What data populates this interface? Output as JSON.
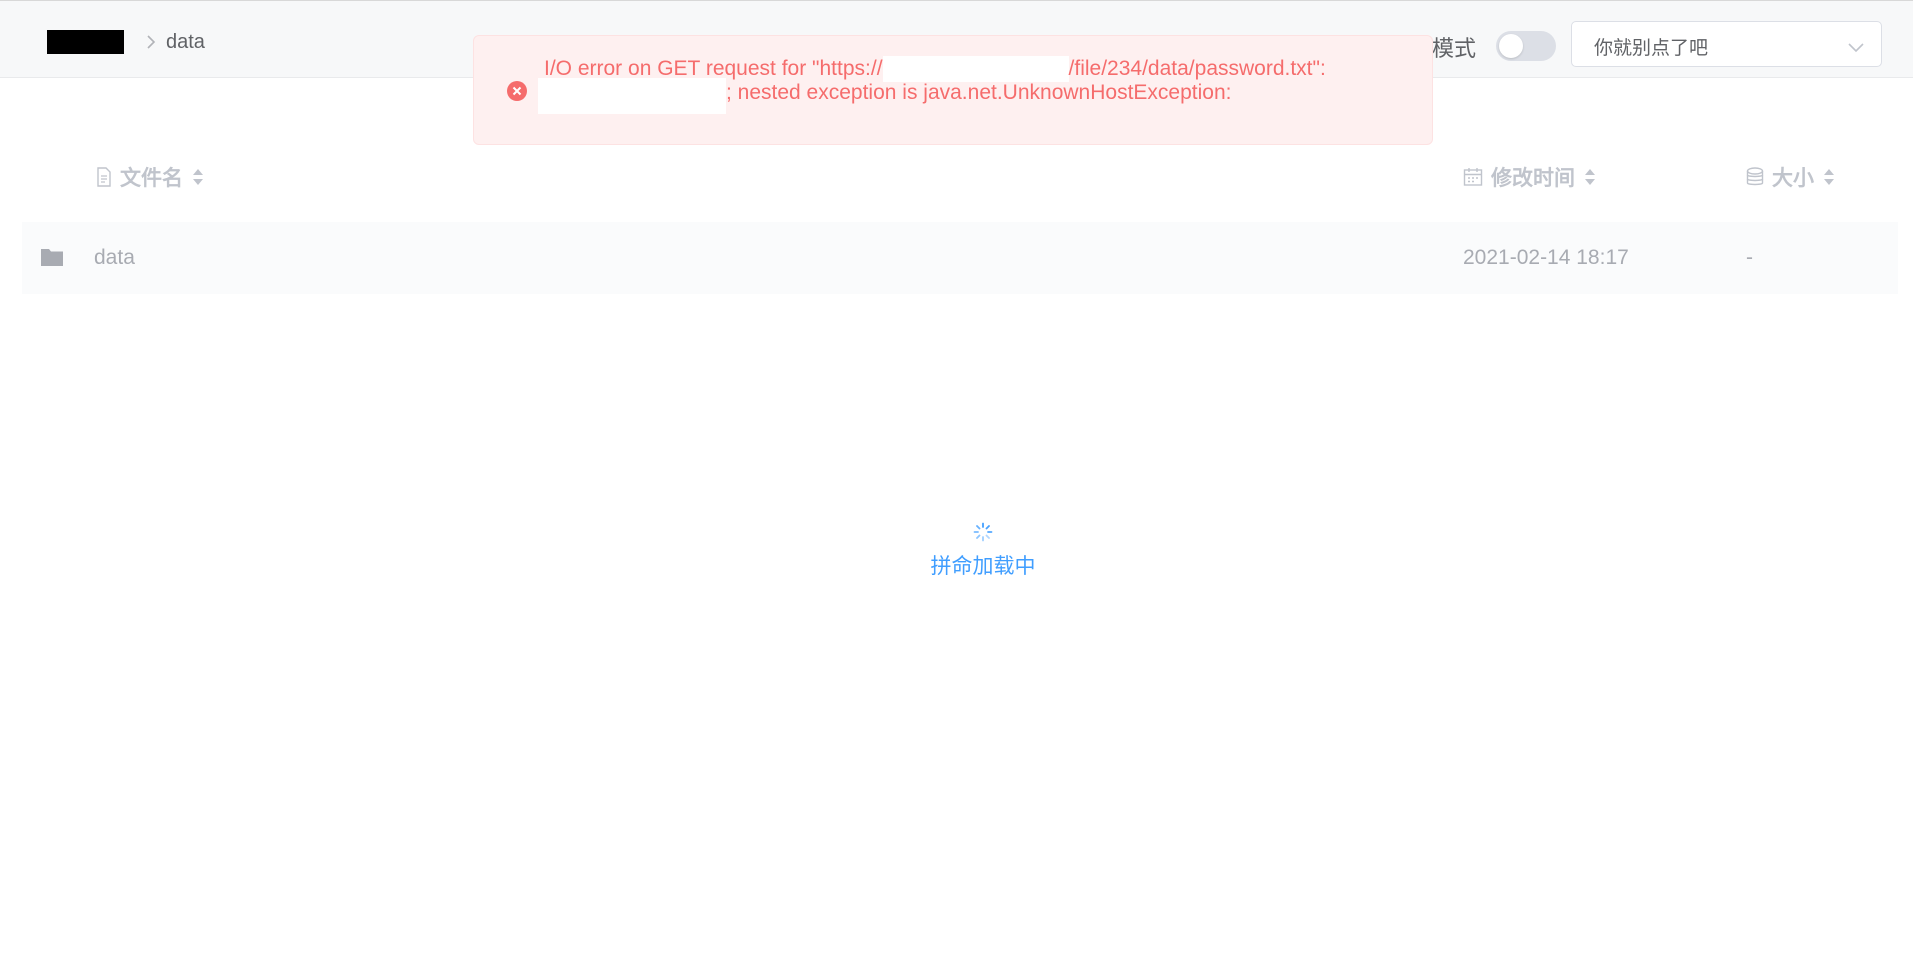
{
  "header": {
    "breadcrumb_current": "data",
    "mode_label": "模式",
    "toggle_on": false,
    "select_value": "你就别点了吧"
  },
  "alert": {
    "line1_prefix": "I/O error on GET request for \"https://",
    "line1_suffix": "/file/234/data/password.txt\":",
    "line2_suffix": "; nested exception is java.net.UnknownHostException:",
    "color": "#f56c6c"
  },
  "table": {
    "columns": {
      "name": "文件名",
      "time": "修改时间",
      "size": "大小"
    },
    "rows": [
      {
        "name": "data",
        "time": "2021-02-14 18:17",
        "size": "-"
      }
    ]
  },
  "loading": {
    "text": "拼命加载中",
    "color": "#409eff"
  }
}
